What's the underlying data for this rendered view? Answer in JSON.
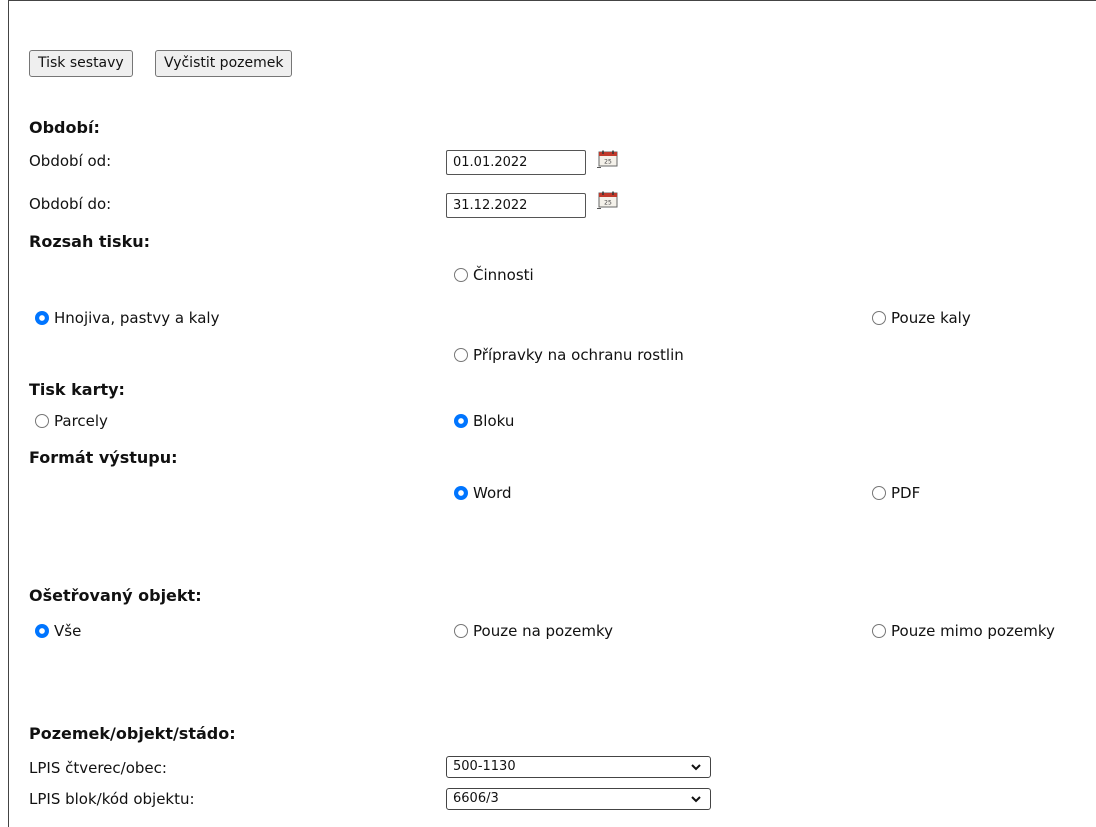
{
  "toolbar": {
    "print_label": "Tisk sestavy",
    "clear_label": "Vyčistit pozemek"
  },
  "period": {
    "heading": "Období:",
    "from_label": "Období od:",
    "from_value": "01.01.2022",
    "to_label": "Období do:",
    "to_value": "31.12.2022",
    "calendar_icon": "calendar-icon"
  },
  "print_range": {
    "heading": "Rozsah tisku:",
    "options": [
      "Činnosti",
      "Hnojiva, pastvy a kaly",
      "Pouze kaly",
      "Přípravky na ochranu rostlin"
    ],
    "selected": "Hnojiva, pastvy a kaly"
  },
  "card_print": {
    "heading": "Tisk karty:",
    "options": [
      "Parcely",
      "Bloku"
    ],
    "selected": "Bloku"
  },
  "output_format": {
    "heading": "Formát výstupu:",
    "options": [
      "Word",
      "PDF"
    ],
    "selected": "Word"
  },
  "treated_object": {
    "heading": "Ošetřovaný objekt:",
    "options": [
      "Vše",
      "Pouze na pozemky",
      "Pouze mimo pozemky"
    ],
    "selected": "Vše"
  },
  "plot": {
    "heading": "Pozemek/objekt/stádo:",
    "square_label": "LPIS čtverec/obec:",
    "square_value": "500-1130",
    "block_label": "LPIS blok/kód objektu:",
    "block_value": "6606/3"
  },
  "colors": {
    "radio_selected": "#0075ff",
    "button_bg": "#efefef",
    "border": "#444444"
  }
}
